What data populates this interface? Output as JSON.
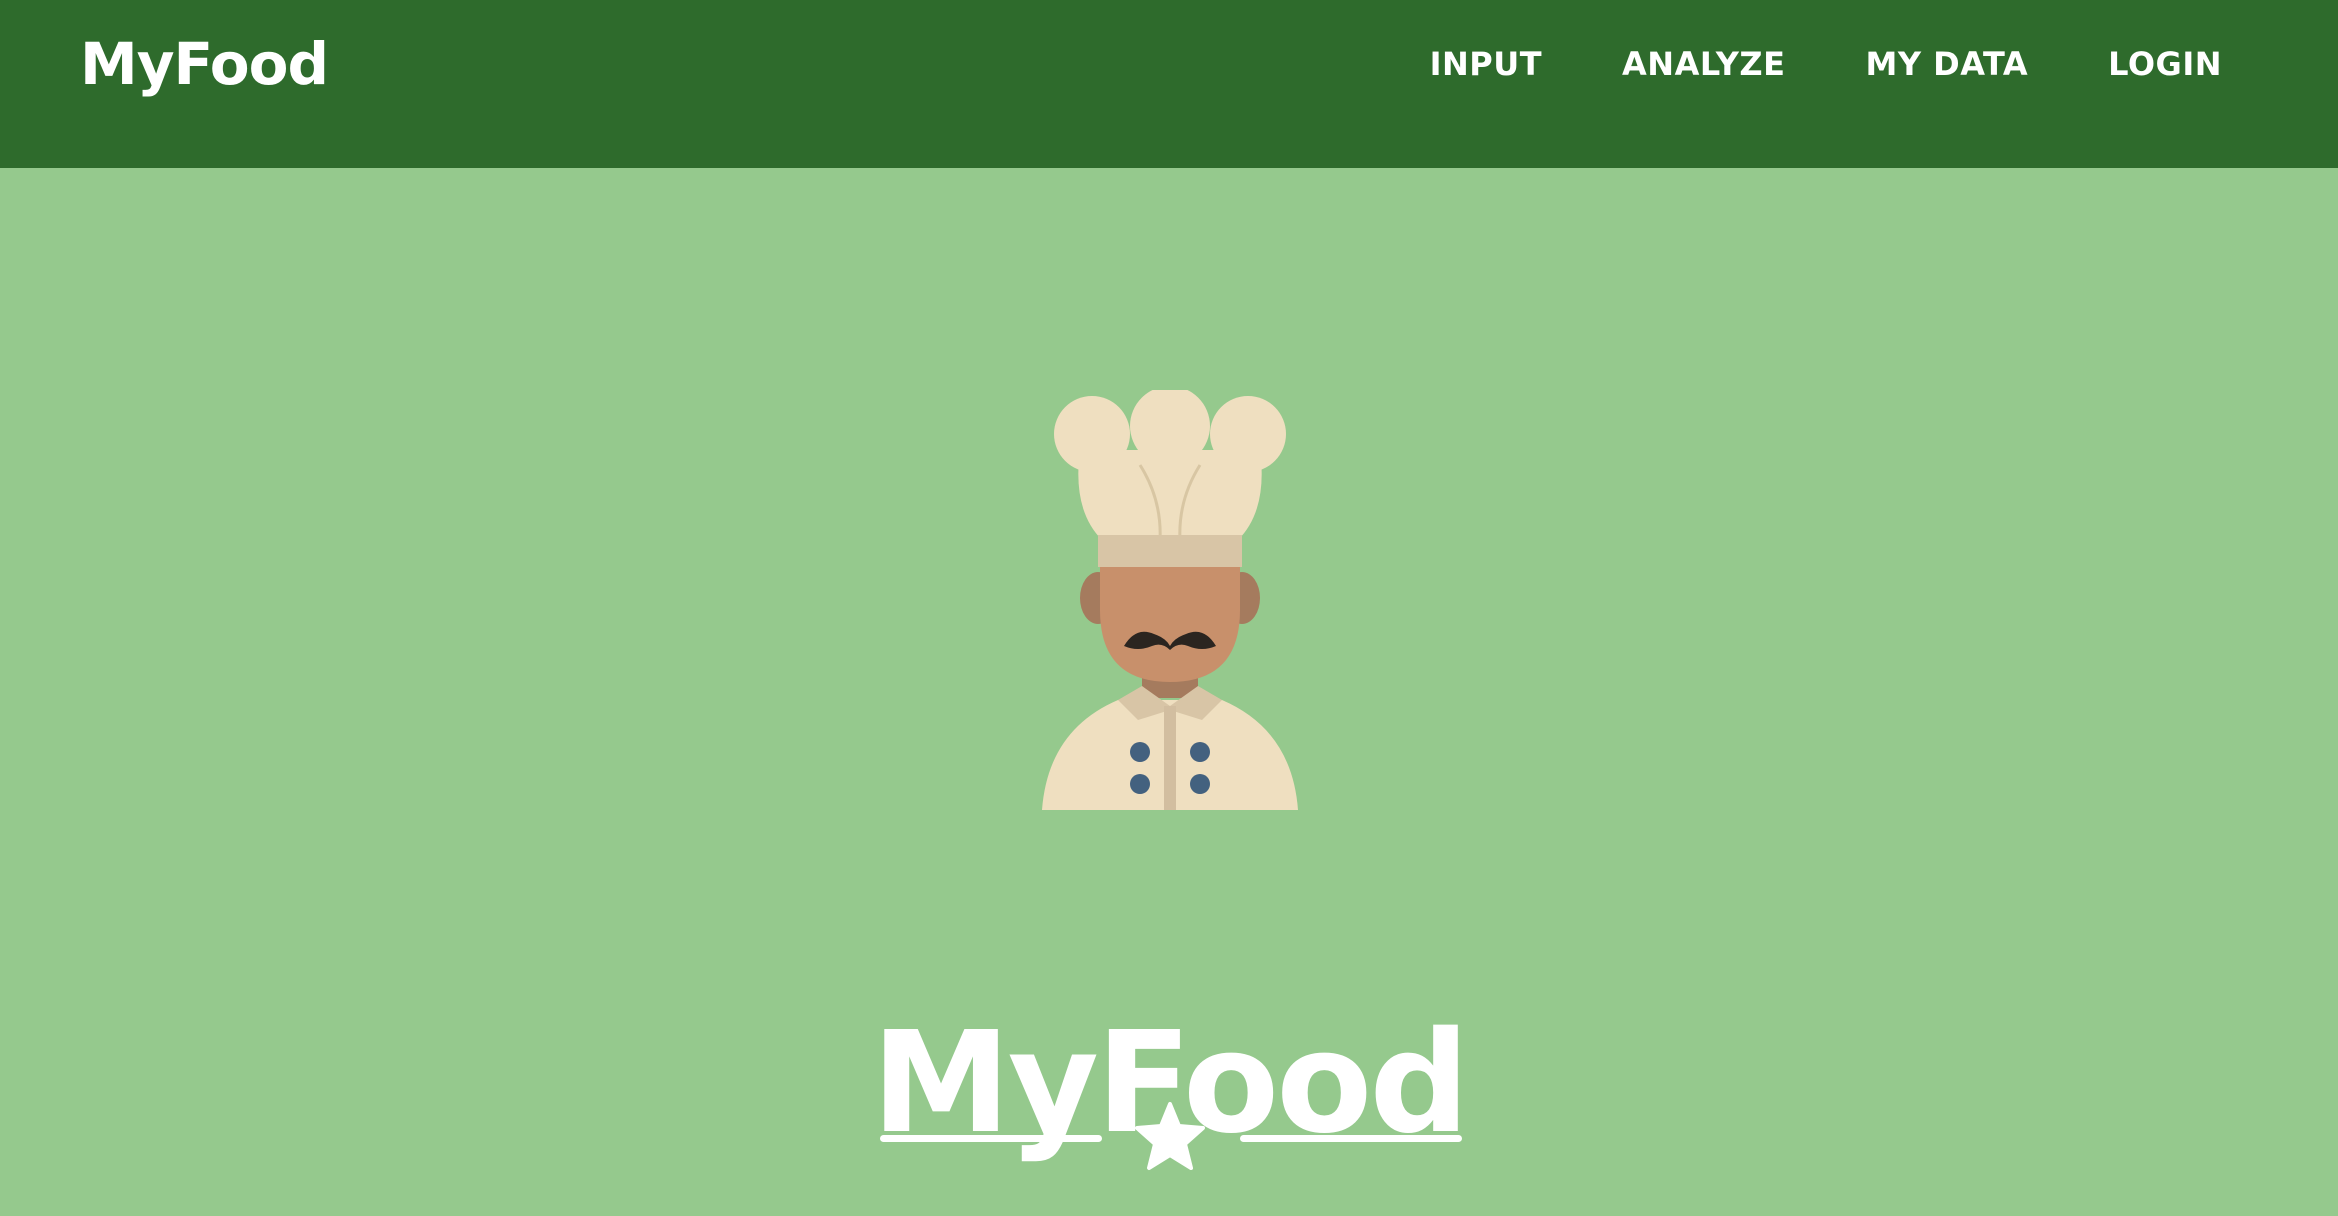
{
  "navbar": {
    "brand": "MyFood",
    "links": [
      {
        "label": "INPUT"
      },
      {
        "label": "ANALYZE"
      },
      {
        "label": "MY DATA"
      },
      {
        "label": "LOGIN"
      }
    ],
    "background_color": "#2e6b2c"
  },
  "masthead": {
    "title": "MyFood",
    "background_color": "#95c98d",
    "avatar_icon": "chef-avatar-icon",
    "divider_icon": "star-icon"
  }
}
